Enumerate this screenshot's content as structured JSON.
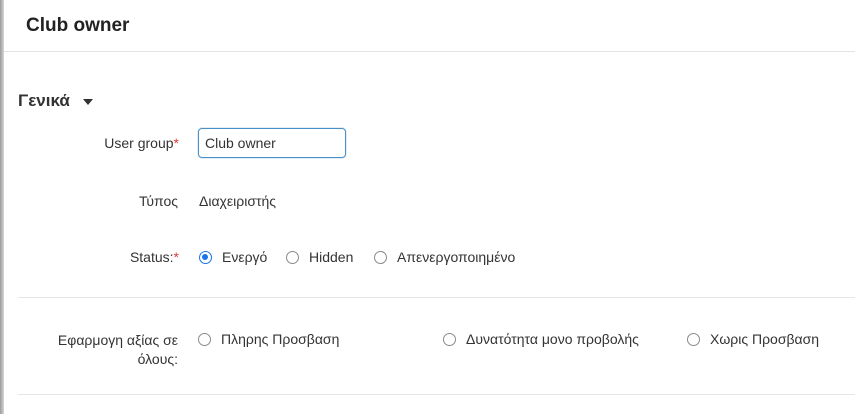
{
  "header": {
    "title": "Club owner"
  },
  "section": {
    "title": "Γενικά"
  },
  "form": {
    "user_group": {
      "label": "User group",
      "required_mark": "*",
      "value": "Club owner"
    },
    "type": {
      "label": "Τύπος",
      "value": "Διαχειριστής"
    },
    "status": {
      "label": "Status:",
      "required_mark": "*",
      "selected": "Ενεργό",
      "options": [
        "Ενεργό",
        "Hidden",
        "Απενεργοποιημένο"
      ]
    },
    "apply_all": {
      "label_line1": "Εφαρμογη αξίας σε",
      "label_line2": "όλους:",
      "options": [
        "Πληρης Προσβαση",
        "Δυνατότητα μονο προβολής",
        "Χωρις Προσβαση"
      ]
    }
  },
  "colors": {
    "accent": "#1a73e8",
    "input_border": "#4a90c8",
    "required": "#e53935"
  },
  "icons": {
    "section_toggle": "caret-down-icon"
  }
}
